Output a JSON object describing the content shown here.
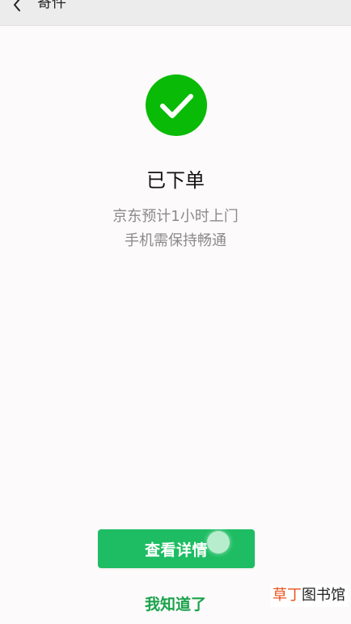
{
  "header": {
    "title": "寄件",
    "back_icon": "chevron-left-icon"
  },
  "result": {
    "icon": "checkmark-icon",
    "icon_color": "#09bb07",
    "title": "已下单",
    "desc_line1": "京东预计1小时上门",
    "desc_line2": "手机需保持畅通"
  },
  "actions": {
    "primary_label": "查看详情",
    "primary_color": "#1ebd63",
    "secondary_label": "我知道了",
    "secondary_color": "#1aa34a"
  },
  "watermark": {
    "part1": "草丁",
    "part2": "图书馆"
  }
}
